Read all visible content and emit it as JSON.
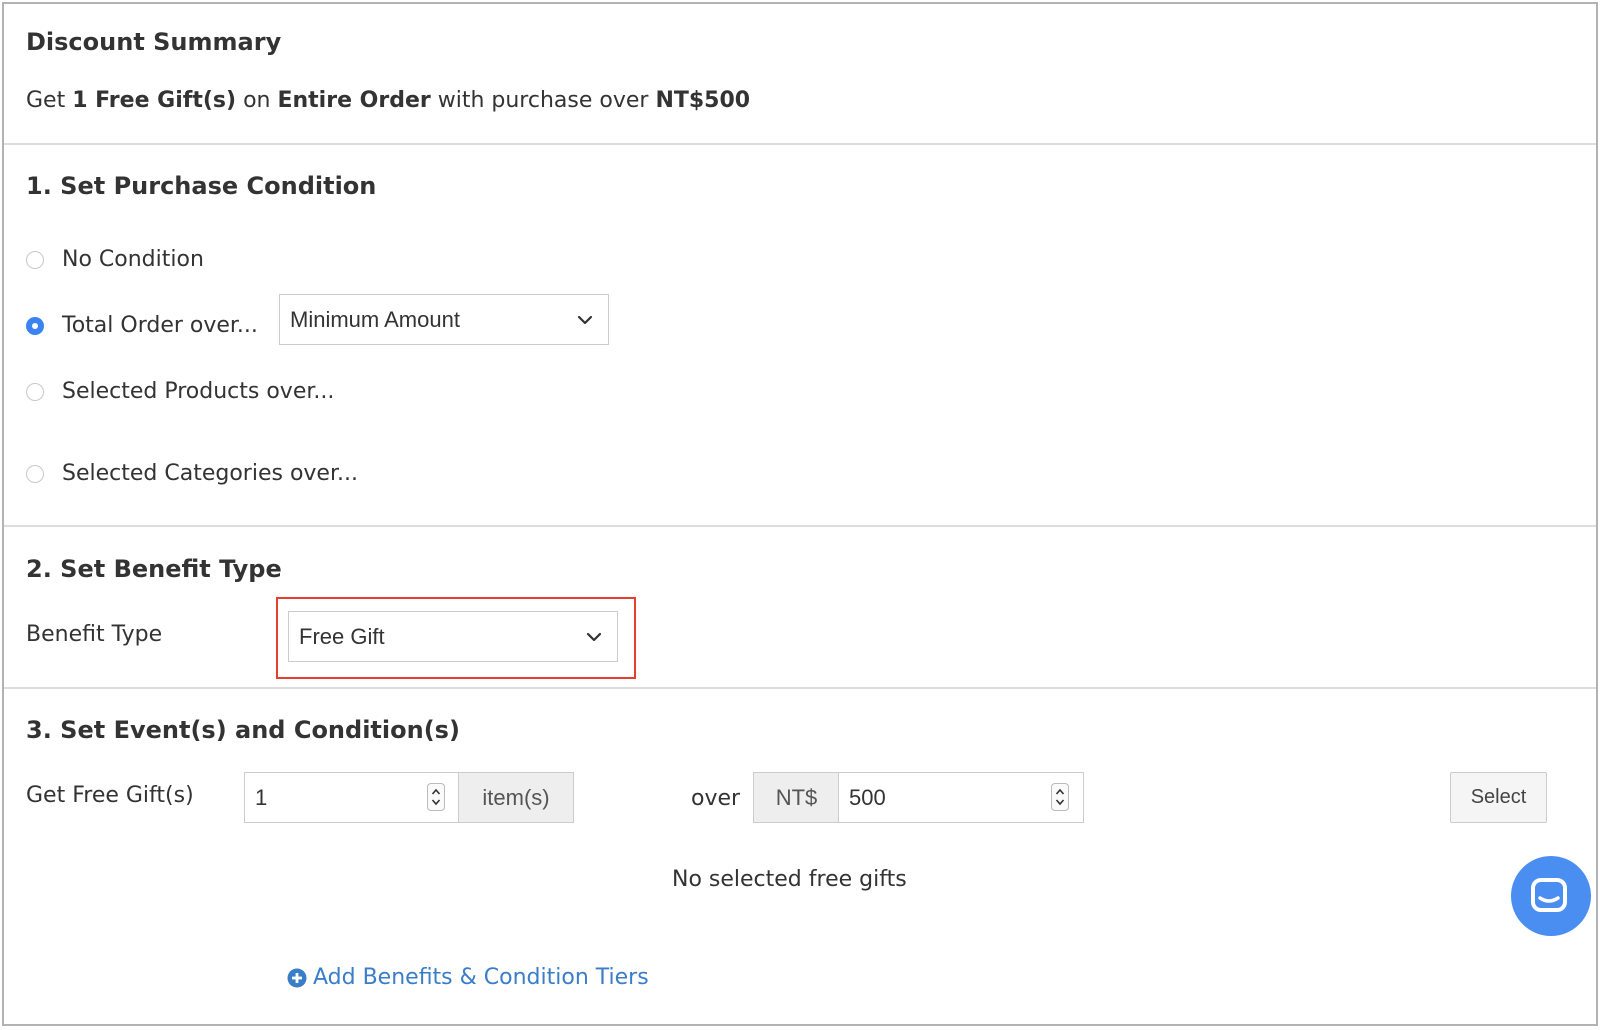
{
  "summary": {
    "title": "Discount Summary",
    "text_get": "Get",
    "text_qty": "1 Free Gift(s)",
    "text_on": "on",
    "text_scope": "Entire Order",
    "text_with": "with purchase over",
    "text_amount": "NT$500"
  },
  "purchase_condition": {
    "title": "1. Set Purchase Condition",
    "options": [
      {
        "label": "No Condition",
        "checked": false
      },
      {
        "label": "Total Order over...",
        "checked": true
      },
      {
        "label": "Selected Products over...",
        "checked": false
      },
      {
        "label": "Selected Categories over...",
        "checked": false
      }
    ],
    "threshold_select_value": "Minimum Amount"
  },
  "benefit": {
    "title": "2. Set Benefit Type",
    "label": "Benefit Type",
    "select_value": "Free Gift",
    "highlight_color": "#e5402e"
  },
  "events": {
    "title": "3. Set Event(s) and Condition(s)",
    "gift_label": "Get Free Gift(s)",
    "gift_qty": "1",
    "gift_unit": "item(s)",
    "over_label": "over",
    "currency": "NT$",
    "amount": "500",
    "select_button": "Select",
    "empty_message": "No selected free gifts",
    "add_tiers_link": "Add Benefits & Condition Tiers"
  },
  "colors": {
    "accent": "#3a83f1",
    "link": "#3a7dc9",
    "chat_button": "#4a8ef2"
  }
}
